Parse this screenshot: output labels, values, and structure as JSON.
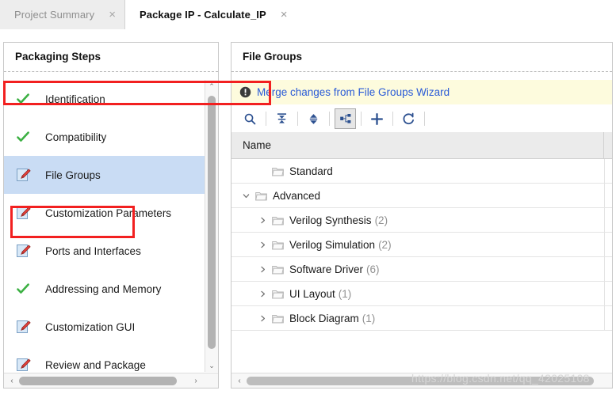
{
  "tabs": [
    {
      "label": "Project Summary",
      "active": false,
      "close_icon": "×"
    },
    {
      "label": "Package IP - Calculate_IP",
      "active": true,
      "close_icon": "×"
    }
  ],
  "left_panel": {
    "title": "Packaging Steps",
    "steps": [
      {
        "label": "Identification",
        "icon": "check-icon",
        "selected": false
      },
      {
        "label": "Compatibility",
        "icon": "check-icon",
        "selected": false
      },
      {
        "label": "File Groups",
        "icon": "edit-icon",
        "selected": true
      },
      {
        "label": "Customization Parameters",
        "icon": "edit-icon",
        "selected": false
      },
      {
        "label": "Ports and Interfaces",
        "icon": "edit-icon",
        "selected": false
      },
      {
        "label": "Addressing and Memory",
        "icon": "check-icon",
        "selected": false
      },
      {
        "label": "Customization GUI",
        "icon": "edit-icon",
        "selected": false
      },
      {
        "label": "Review and Package",
        "icon": "edit-icon",
        "selected": false
      }
    ],
    "scroll_up_icon": "⌃",
    "scroll_down_icon": "⌄",
    "scroll_left_icon": "‹",
    "scroll_right_icon": "›"
  },
  "right_panel": {
    "title": "File Groups",
    "banner": {
      "icon": "info-exclamation-icon",
      "link_text": "Merge changes from File Groups Wizard",
      "background": "#fdfbdd",
      "link_color": "#2a5bd7"
    },
    "toolbar": [
      {
        "name": "search-icon",
        "tooltip": "Search",
        "pressed": false
      },
      {
        "name": "collapse-all-icon",
        "tooltip": "Collapse All",
        "pressed": false
      },
      {
        "name": "expand-collapse-icon",
        "tooltip": "Expand All",
        "pressed": false
      },
      {
        "name": "hierarchy-icon",
        "tooltip": "Hierarchy",
        "pressed": true
      },
      {
        "name": "add-icon",
        "tooltip": "Add",
        "pressed": false
      },
      {
        "name": "refresh-icon",
        "tooltip": "Refresh",
        "pressed": false
      }
    ],
    "tree": {
      "column_header": "Name",
      "rows": [
        {
          "label": "Standard",
          "count": "",
          "indent": 1,
          "twisty": "none"
        },
        {
          "label": "Advanced",
          "count": "",
          "indent": 0,
          "twisty": "down"
        },
        {
          "label": "Verilog Synthesis",
          "count": "(2)",
          "indent": 1,
          "twisty": "right"
        },
        {
          "label": "Verilog Simulation",
          "count": "(2)",
          "indent": 1,
          "twisty": "right"
        },
        {
          "label": "Software Driver",
          "count": "(6)",
          "indent": 1,
          "twisty": "right"
        },
        {
          "label": "UI Layout",
          "count": "(1)",
          "indent": 1,
          "twisty": "right"
        },
        {
          "label": "Block Diagram",
          "count": "(1)",
          "indent": 1,
          "twisty": "right"
        }
      ]
    },
    "scroll_left_icon": "‹"
  },
  "highlights": {
    "color": "#f22020",
    "step_target": "File Groups",
    "banner_target": "Merge changes from File Groups Wizard"
  },
  "watermark": "https://blog.csdn.net/qq_42025108"
}
